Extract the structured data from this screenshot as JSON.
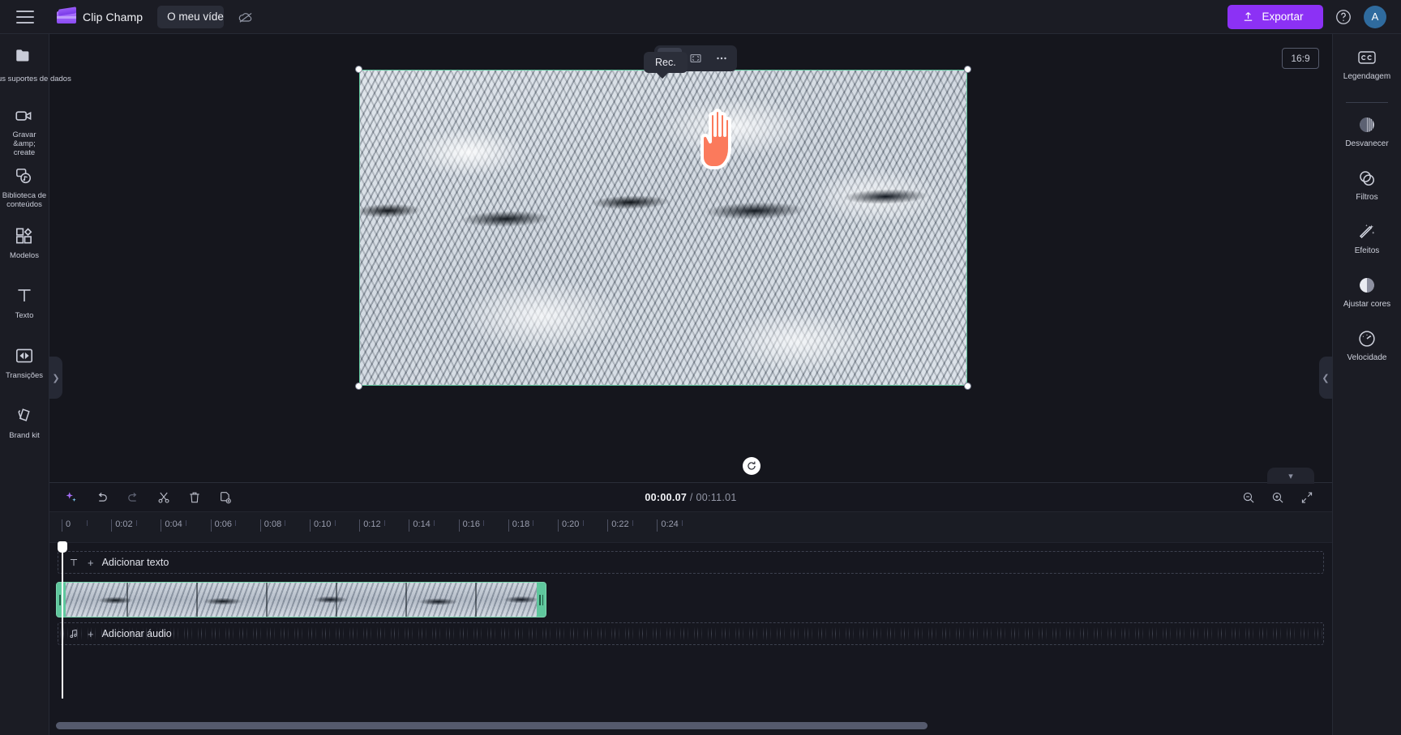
{
  "app": {
    "brand_name": "Clip Champ",
    "project_name": "O meu vídeo",
    "export_label": "Exportar",
    "avatar_initial": "A"
  },
  "left_rail": {
    "items": [
      {
        "label": "Os seus suportes de dados",
        "icon": "folder-icon"
      },
      {
        "label": "Gravar &amp; create",
        "icon": "video-camera-icon"
      },
      {
        "label": "Biblioteca de conteúdos",
        "icon": "content-library-icon"
      },
      {
        "label": "Modelos",
        "icon": "templates-icon"
      },
      {
        "label": "Texto",
        "icon": "text-icon"
      },
      {
        "label": "Transições",
        "icon": "transitions-icon"
      },
      {
        "label": "Brand kit",
        "icon": "brand-kit-icon"
      }
    ]
  },
  "right_rail": {
    "items": [
      {
        "label": "Legendagem",
        "icon": "closed-captions-icon"
      },
      {
        "label": "Desvanecer",
        "icon": "fade-icon"
      },
      {
        "label": "Filtros",
        "icon": "filters-icon"
      },
      {
        "label": "Efeitos",
        "icon": "effects-icon"
      },
      {
        "label": "Ajustar cores",
        "icon": "adjust-colors-icon"
      },
      {
        "label": "Velocidade",
        "icon": "speed-icon"
      }
    ]
  },
  "stage": {
    "tooltip": "Rec.",
    "aspect_ratio": "16:9",
    "toolbar": {
      "crop_label": "crop-icon",
      "fit_label": "fit-to-frame-icon",
      "more_label": "more-options-icon"
    }
  },
  "timeline": {
    "current_time": "00:00.07",
    "separator": "/",
    "total_time": "00:11.01",
    "toolbar": [
      {
        "name": "ai-sparkle-button",
        "icon": "sparkle-icon"
      },
      {
        "name": "undo-button",
        "icon": "undo-icon"
      },
      {
        "name": "redo-button",
        "icon": "redo-icon"
      },
      {
        "name": "split-button",
        "icon": "scissors-icon"
      },
      {
        "name": "delete-button",
        "icon": "trash-icon"
      },
      {
        "name": "duplicate-button",
        "icon": "duplicate-icon"
      }
    ],
    "ruler_labels": [
      "0:02",
      "0:04",
      "0:06",
      "0:08",
      "0:10",
      "0:12",
      "0:14",
      "0:16",
      "0:18",
      "0:20",
      "0:22",
      "0:24"
    ],
    "tracks": {
      "add_text": "Adicionar texto",
      "add_audio": "Adicionar áudio",
      "plus": "+"
    },
    "zoom_controls": [
      {
        "name": "zoom-out-button",
        "icon": "magnifier-minus-icon"
      },
      {
        "name": "zoom-in-button",
        "icon": "magnifier-plus-icon"
      },
      {
        "name": "fit-timeline-button",
        "icon": "shrink-arrows-icon"
      }
    ]
  },
  "colors": {
    "accent": "#8c31f5",
    "selection": "#63c9a0",
    "topbar_bg": "#1b1c24",
    "stage_bg": "#15161d"
  }
}
